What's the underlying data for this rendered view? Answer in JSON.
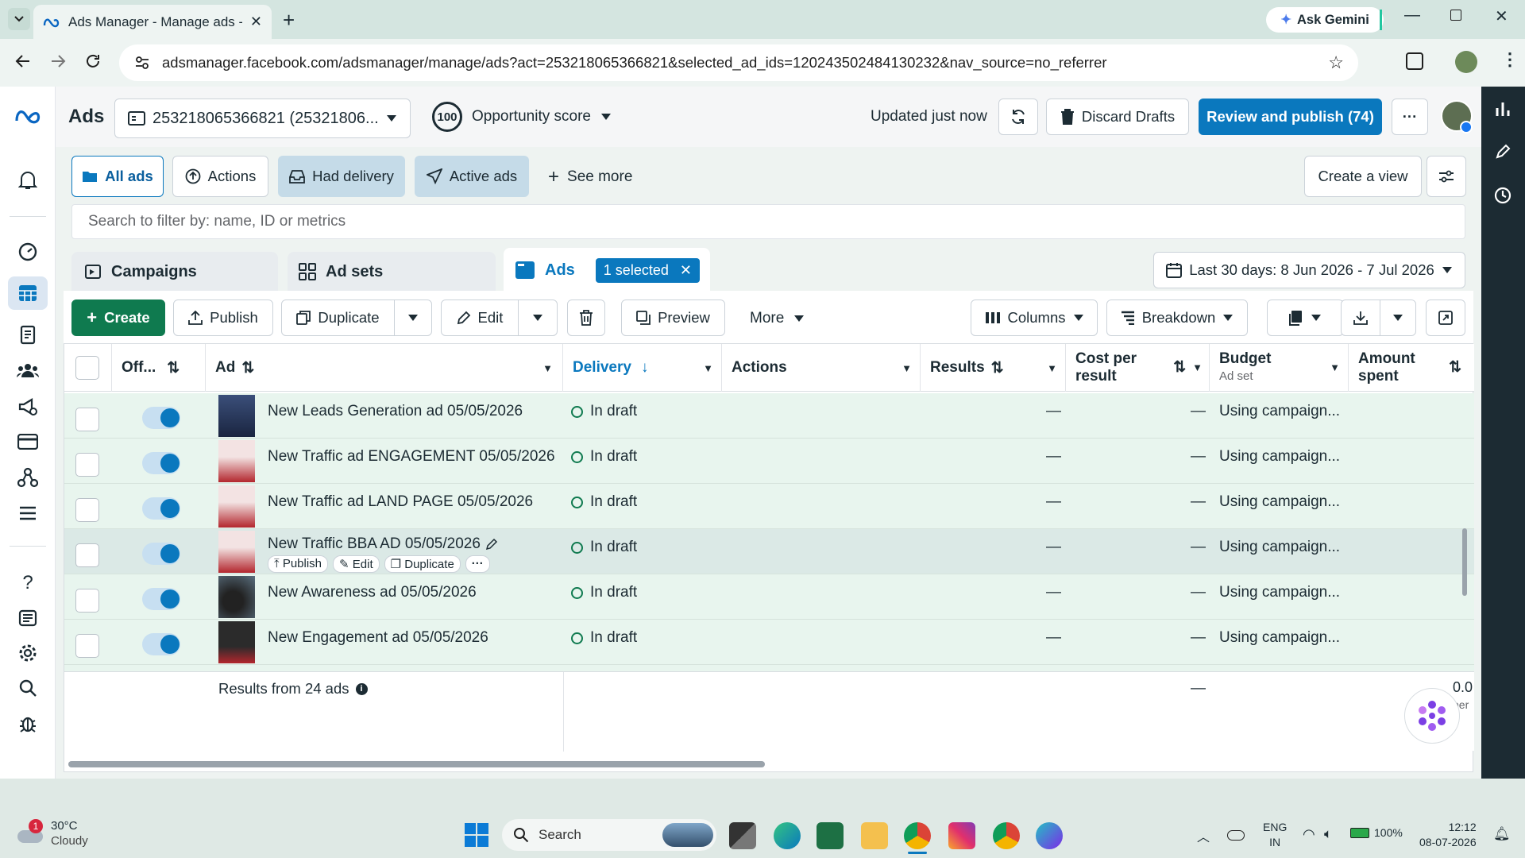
{
  "browser": {
    "tab_title": "Ads Manager - Manage ads - C",
    "ask_gemini": "Ask Gemini",
    "url": "adsmanager.facebook.com/adsmanager/manage/ads?act=253218065366821&selected_ad_ids=120243502484130232&nav_source=no_referrer"
  },
  "header": {
    "app_label": "Ads",
    "account": "253218065366821 (25321806...",
    "opp_score_value": "100",
    "opp_score_label": "Opportunity score",
    "updated": "Updated just now",
    "discard": "Discard Drafts",
    "review": "Review and publish (74)",
    "more": "···"
  },
  "filters": {
    "all_ads": "All ads",
    "actions": "Actions",
    "had_delivery": "Had delivery",
    "active_ads": "Active ads",
    "see_more": "See more",
    "create_view": "Create a view",
    "search_placeholder": "Search to filter by: name, ID or metrics"
  },
  "levels": {
    "campaigns": "Campaigns",
    "ad_sets": "Ad sets",
    "ads": "Ads",
    "selected": "1 selected",
    "date_range": "Last 30 days: 8 Jun 2026 - 7 Jul 2026"
  },
  "toolbar": {
    "create": "Create",
    "publish": "Publish",
    "duplicate": "Duplicate",
    "edit": "Edit",
    "preview": "Preview",
    "more": "More",
    "columns": "Columns",
    "breakdown": "Breakdown"
  },
  "table": {
    "headers": {
      "off": "Off...",
      "ad": "Ad",
      "delivery": "Delivery",
      "actions": "Actions",
      "results": "Results",
      "cost_per_result_1": "Cost per",
      "cost_per_result_2": "result",
      "budget": "Budget",
      "budget_sub": "Ad set",
      "amount_1": "Amount",
      "amount_2": "spent"
    },
    "rows": [
      {
        "name": "New Leads Generation ad 05/05/2026",
        "delivery": "In draft",
        "results": "—",
        "cost": "—",
        "budget": "Using campaign..."
      },
      {
        "name": "New Traffic ad ENGAGEMENT 05/05/2026",
        "delivery": "In draft",
        "results": "—",
        "cost": "—",
        "budget": "Using campaign..."
      },
      {
        "name": "New Traffic ad LAND PAGE 05/05/2026",
        "delivery": "In draft",
        "results": "—",
        "cost": "—",
        "budget": "Using campaign..."
      },
      {
        "name": "New Traffic BBA AD 05/05/2026",
        "delivery": "In draft",
        "results": "—",
        "cost": "—",
        "budget": "Using campaign..."
      },
      {
        "name": "New Awareness ad 05/05/2026",
        "delivery": "In draft",
        "results": "—",
        "cost": "—",
        "budget": "Using campaign..."
      },
      {
        "name": "New Engagement ad 05/05/2026",
        "delivery": "In draft",
        "results": "—",
        "cost": "—",
        "budget": "Using campaign..."
      }
    ],
    "row_actions": {
      "publish": "Publish",
      "edit": "Edit",
      "duplicate": "Duplicate"
    },
    "footer_results": "Results from 24 ads",
    "footer_dash": "—",
    "footer_amount": "0.0",
    "footer_amount_sub": "per"
  },
  "taskbar": {
    "temp": "30°C",
    "weather": "Cloudy",
    "weather_badge": "1",
    "search": "Search",
    "lang1": "ENG",
    "lang2": "IN",
    "battery": "100%",
    "time": "12:12",
    "date": "08-07-2026"
  },
  "colors": {
    "brand_blue": "#0a78be",
    "create_green": "#0f7a4f",
    "row_bg": "#e8f5ee",
    "rail": "#1c2b33"
  }
}
